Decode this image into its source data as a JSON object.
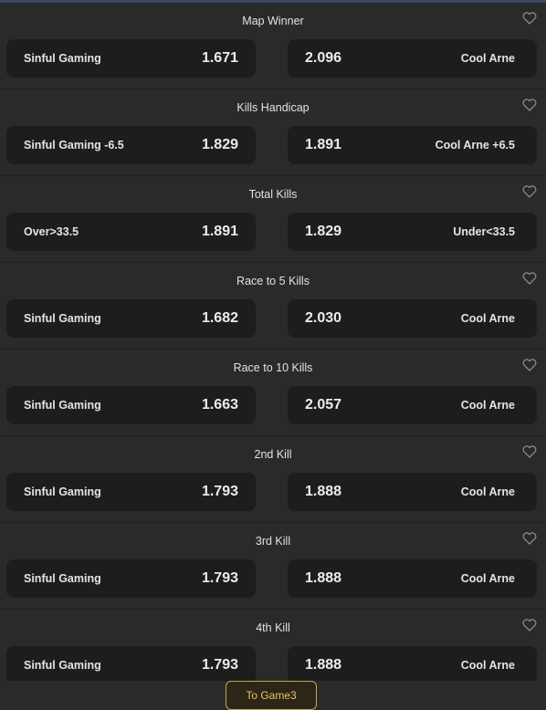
{
  "markets": [
    {
      "title": "Map Winner",
      "left": {
        "name": "Sinful Gaming",
        "odds": "1.671"
      },
      "right": {
        "name": "Cool Arne",
        "odds": "2.096"
      }
    },
    {
      "title": "Kills Handicap",
      "left": {
        "name": "Sinful Gaming -6.5",
        "odds": "1.829"
      },
      "right": {
        "name": "Cool Arne +6.5",
        "odds": "1.891"
      }
    },
    {
      "title": "Total Kills",
      "left": {
        "name": "Over>33.5",
        "odds": "1.891"
      },
      "right": {
        "name": "Under<33.5",
        "odds": "1.829"
      }
    },
    {
      "title": "Race to 5 Kills",
      "left": {
        "name": "Sinful Gaming",
        "odds": "1.682"
      },
      "right": {
        "name": "Cool Arne",
        "odds": "2.030"
      }
    },
    {
      "title": "Race to 10 Kills",
      "left": {
        "name": "Sinful Gaming",
        "odds": "1.663"
      },
      "right": {
        "name": "Cool Arne",
        "odds": "2.057"
      }
    },
    {
      "title": "2nd Kill",
      "left": {
        "name": "Sinful Gaming",
        "odds": "1.793"
      },
      "right": {
        "name": "Cool Arne",
        "odds": "1.888"
      }
    },
    {
      "title": "3rd Kill",
      "left": {
        "name": "Sinful Gaming",
        "odds": "1.793"
      },
      "right": {
        "name": "Cool Arne",
        "odds": "1.888"
      }
    },
    {
      "title": "4th Kill",
      "left": {
        "name": "Sinful Gaming",
        "odds": "1.793"
      },
      "right": {
        "name": "Cool Arne",
        "odds": "1.888"
      }
    }
  ],
  "footer": {
    "to_game_label": "To Game3"
  },
  "icons": {
    "favorite": "heart-outline-icon"
  },
  "colors": {
    "accent": "#e7c35c",
    "accent_border": "#c9a24a",
    "background": "#2a2a2a",
    "button": "#1d1d1d"
  }
}
